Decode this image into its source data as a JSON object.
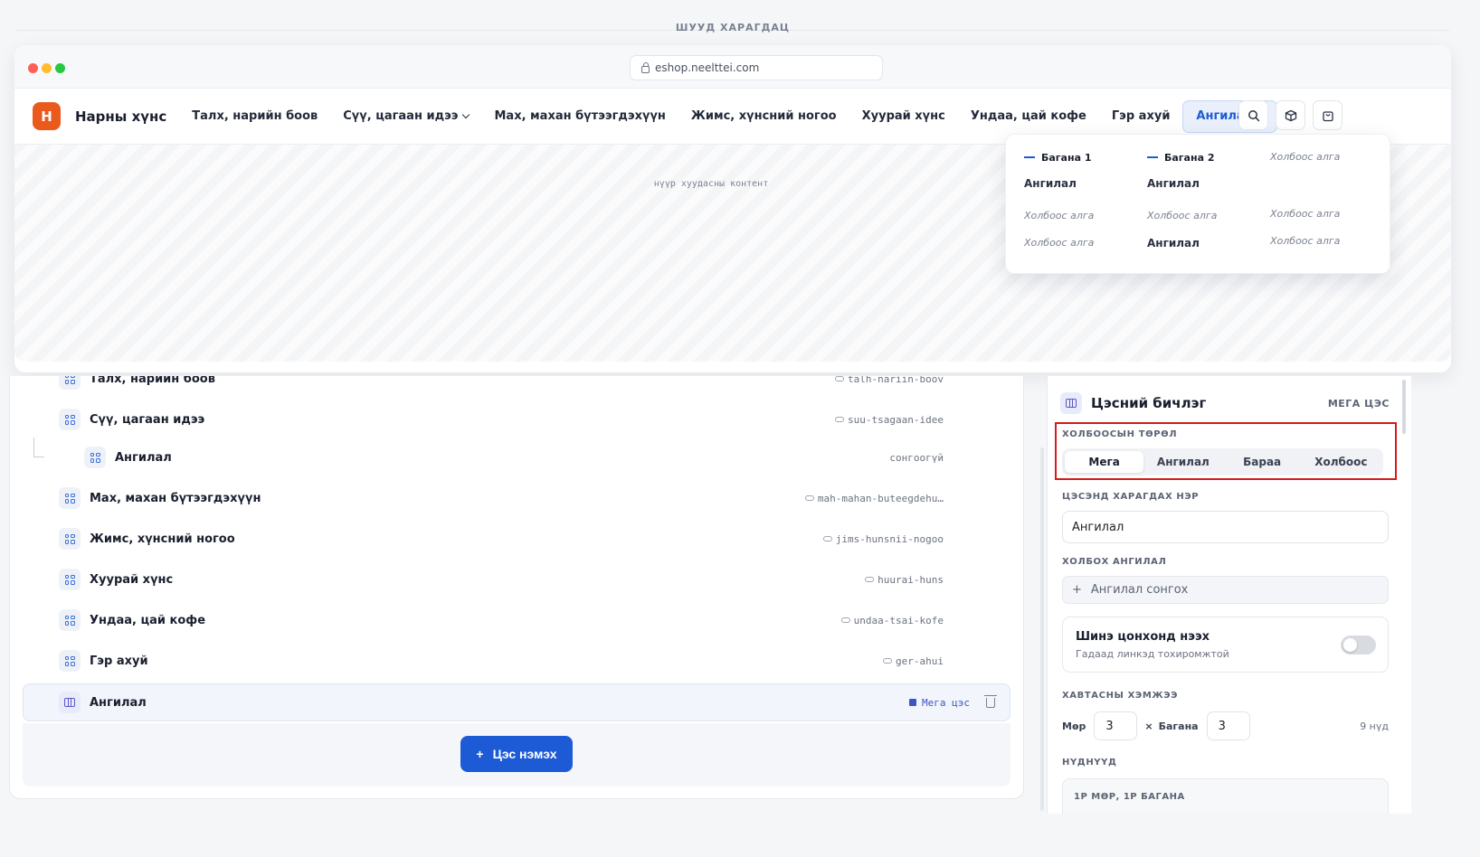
{
  "preview": {
    "label": "ШУУД ХАРАГДАЦ"
  },
  "browser": {
    "url": "eshop.neelttei.com"
  },
  "store": {
    "logo_letter": "Н",
    "brand": "Нарны хүнс",
    "nav": [
      {
        "label": "Талх, нарийн боов"
      },
      {
        "label": "Сүү, цагаан идээ"
      },
      {
        "label": "Мах, махан бүтээгдэхүүн"
      },
      {
        "label": "Жимс, хүнсний ногоо"
      },
      {
        "label": "Хуурай хүнс"
      },
      {
        "label": "Ундаа, цай кофе"
      },
      {
        "label": "Гэр ахуй"
      },
      {
        "label": "Ангилал"
      }
    ],
    "page_placeholder": "нүүр хуудасны контент"
  },
  "mega_menu": {
    "col1_header": "Багана 1",
    "col2_header": "Багана 2",
    "category": "Ангилал",
    "empty": "Холбоос алга"
  },
  "tree": {
    "items": [
      {
        "label": "Талх, нарийн боов",
        "slug": "talh-nariin-boov"
      },
      {
        "label": "Сүү, цагаан идээ",
        "slug": "suu-tsagaan-idee"
      },
      {
        "label": "Ангилал",
        "slug": "сонгоогүй"
      },
      {
        "label": "Мах, махан бүтээгдэхүүн",
        "slug": "mah-mahan-buteegdehu…"
      },
      {
        "label": "Жимс, хүнсний ногоо",
        "slug": "jims-hunsnii-nogoo"
      },
      {
        "label": "Хуурай хүнс",
        "slug": "huurai-huns"
      },
      {
        "label": "Ундаа, цай кофе",
        "slug": "undaa-tsai-kofe"
      },
      {
        "label": "Гэр ахуй",
        "slug": "ger-ahui"
      },
      {
        "label": "Ангилал",
        "tag": "Мега цэс"
      }
    ],
    "add_button": "Цэс нэмэх"
  },
  "editor": {
    "title": "Цэсний бичлэг",
    "badge": "МЕГА ЦЭС",
    "link_type_label": "ХОЛБООСЫН ТӨРӨЛ",
    "link_types": [
      "Мега",
      "Ангилал",
      "Бараа",
      "Холбоос"
    ],
    "display_name_label": "ЦЭСЭНД ХАРАГДАХ НЭР",
    "display_name_value": "Ангилал",
    "link_category_label": "ХОЛБОХ АНГИЛАЛ",
    "link_category_placeholder": "Ангилал сонгох",
    "new_window_title": "Шинэ цонхонд нээх",
    "new_window_sub": "Гадаад линкэд тохиромжтой",
    "new_window_on": false,
    "grid_size_label": "ХАВТАСНЫ ХЭМЖЭЭ",
    "rows_label": "Мөр",
    "rows_value": "3",
    "times": "×",
    "cols_label": "Багана",
    "cols_value": "3",
    "cells_total": "9 нүд",
    "cells_label": "НҮДНҮҮД",
    "cell_card_label": "1Р МӨР, 1Р БАГАНА"
  }
}
